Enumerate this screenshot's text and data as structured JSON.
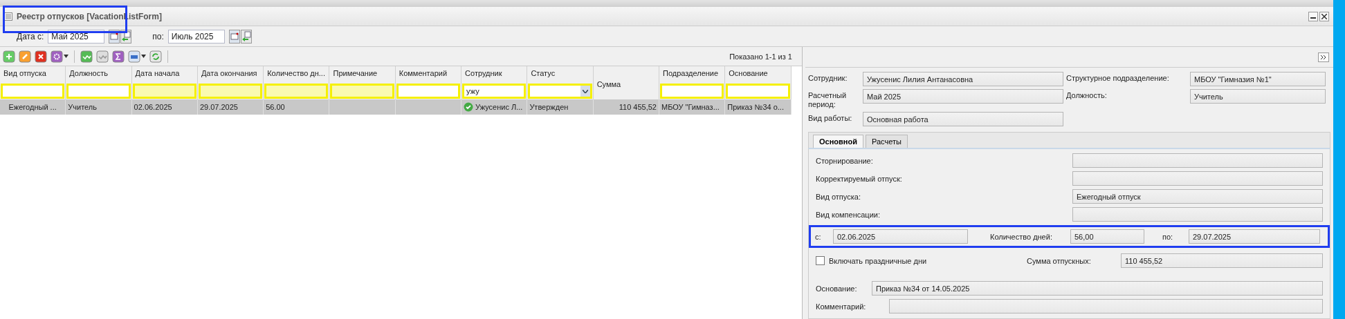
{
  "window": {
    "title": "Реестр отпусков [VacationListForm]",
    "highlighted": true
  },
  "date_filter": {
    "from_label": "Дата с:",
    "from": "Май 2025",
    "to_label": "по:",
    "to": "Июль 2025"
  },
  "paging": "Показано 1-1 из 1",
  "table": {
    "columns": [
      {
        "label": "Вид отпуска",
        "kind": "text",
        "filled": false
      },
      {
        "label": "Должность",
        "kind": "text",
        "filled": false
      },
      {
        "label": "Дата начала",
        "kind": "text",
        "filled": true
      },
      {
        "label": "Дата окончания",
        "kind": "text",
        "filled": true
      },
      {
        "label": "Количество дн...",
        "kind": "text",
        "filled": true
      },
      {
        "label": "Примечание",
        "kind": "text",
        "filled": true
      },
      {
        "label": "Комментарий",
        "kind": "text",
        "filled": false
      },
      {
        "label": "Сотрудник",
        "kind": "text",
        "filled": false,
        "value": "ужу"
      },
      {
        "label": "Статус",
        "kind": "select",
        "filled": false
      },
      {
        "label": "Сумма",
        "kind": "none"
      },
      {
        "label": "Подразделение",
        "kind": "text",
        "filled": false
      },
      {
        "label": "Основание",
        "kind": "text",
        "filled": false
      }
    ],
    "rows": [
      {
        "selected": true,
        "approved": true,
        "cells": [
          "Ежегодный ...",
          "Учитель",
          "02.06.2025",
          "29.07.2025",
          "56.00",
          "",
          "",
          "Ужусенис Л...",
          "Утвержден",
          "110 455,52",
          "МБОУ \"Гимназ...",
          "Приказ №34 о..."
        ]
      }
    ]
  },
  "details": {
    "header_fields": [
      {
        "label": "Сотрудник:",
        "value": "Ужусенис Лилия Антанасовна"
      },
      {
        "label": "Структурное подразделение:",
        "value": "МБОУ \"Гимназия №1\""
      },
      {
        "label": "Расчетный период:",
        "value": "Май 2025"
      },
      {
        "label": "Должность:",
        "value": "Учитель"
      },
      {
        "label": "Вид работы:",
        "value": "Основная работа"
      }
    ],
    "tabs": [
      {
        "label": "Основной",
        "selected": true
      },
      {
        "label": "Расчеты",
        "selected": false
      }
    ],
    "fields": [
      {
        "label": "Сторнирование:"
      },
      {
        "label": "Корректируемый отпуск:"
      },
      {
        "label": "Вид отпуска:",
        "value": "Ежегодный отпуск"
      },
      {
        "label": "Вид компенсации:"
      }
    ],
    "period": {
      "highlighted": true,
      "from_label": "с:",
      "from": "02.06.2025",
      "days_label": "Количество дней:",
      "days": "56,00",
      "to_label": "по:",
      "to": "29.07.2025"
    },
    "include_holidays": {
      "label": "Включать праздничные дни",
      "checked": false
    },
    "sum": {
      "label": "Сумма отпускных:",
      "value": "110 455,52"
    },
    "basis": {
      "label": "Основание:",
      "value": "Приказ №34 от 14.05.2025"
    },
    "comment": {
      "label": "Комментарий:"
    }
  }
}
